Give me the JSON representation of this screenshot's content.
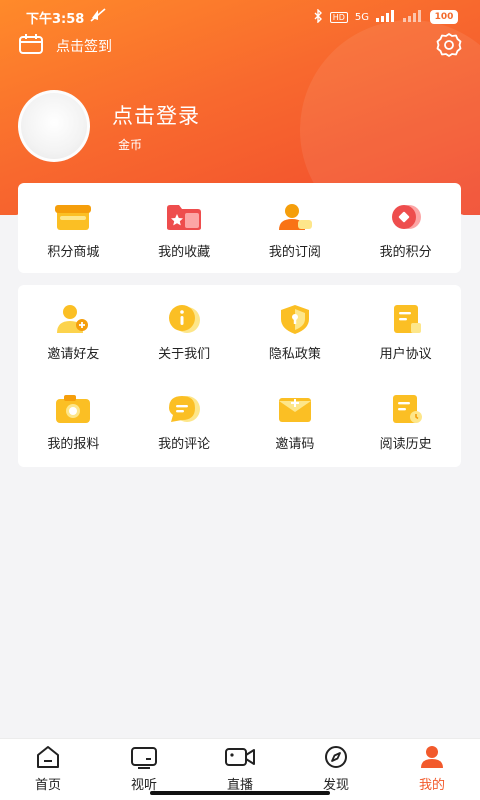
{
  "status": {
    "time": "下午3:58",
    "network": "5G",
    "hd": "HD",
    "battery": "100"
  },
  "header": {
    "checkin_label": "点击签到"
  },
  "profile": {
    "login_label": "点击登录",
    "coins_label": "金币"
  },
  "top_menu": [
    {
      "label": "积分商城",
      "icon": "store-icon"
    },
    {
      "label": "我的收藏",
      "icon": "favorites-folder-icon"
    },
    {
      "label": "我的订阅",
      "icon": "subscription-user-icon"
    },
    {
      "label": "我的积分",
      "icon": "points-icon"
    }
  ],
  "services": [
    {
      "label": "邀请好友",
      "icon": "invite-friend-icon"
    },
    {
      "label": "关于我们",
      "icon": "info-icon"
    },
    {
      "label": "隐私政策",
      "icon": "privacy-shield-icon"
    },
    {
      "label": "用户协议",
      "icon": "agreement-icon"
    },
    {
      "label": "我的报料",
      "icon": "camera-icon"
    },
    {
      "label": "我的评论",
      "icon": "comment-icon"
    },
    {
      "label": "邀请码",
      "icon": "invite-code-icon"
    },
    {
      "label": "阅读历史",
      "icon": "reading-history-icon"
    }
  ],
  "tabs": [
    {
      "label": "首页",
      "icon": "home-icon"
    },
    {
      "label": "视听",
      "icon": "tv-icon"
    },
    {
      "label": "直播",
      "icon": "video-camera-icon"
    },
    {
      "label": "发现",
      "icon": "compass-icon"
    },
    {
      "label": "我的",
      "icon": "user-icon",
      "active": true
    }
  ],
  "colors": {
    "brand": "#f25a2c",
    "icon_yellow": "#fbbf24",
    "icon_red": "#ee4d4d"
  }
}
